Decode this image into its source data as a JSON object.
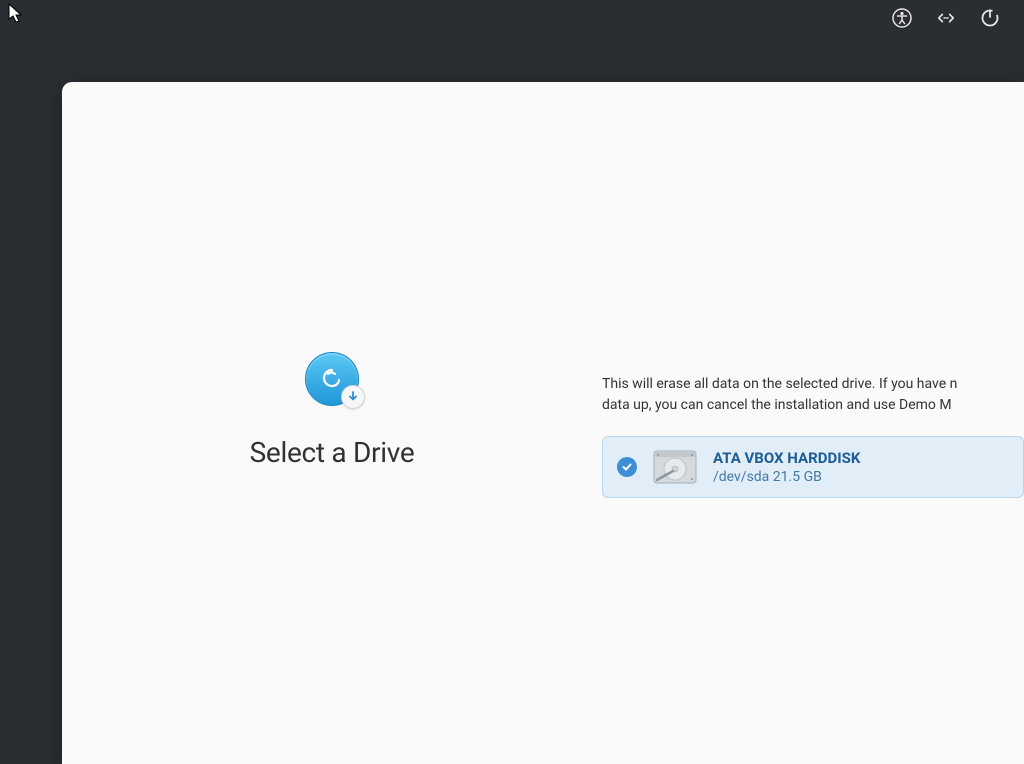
{
  "topbar": {
    "accessibility_icon": "accessibility",
    "network_icon": "network",
    "power_icon": "power"
  },
  "installer": {
    "title": "Select a Drive",
    "warning_line1": "This will erase all data on the selected drive. If you have n",
    "warning_line2": "data up, you can cancel the installation and use Demo M",
    "drives": [
      {
        "name": "ATA VBOX HARDDISK",
        "path": "/dev/sda",
        "size": "21.5 GB",
        "selected": true
      }
    ]
  }
}
